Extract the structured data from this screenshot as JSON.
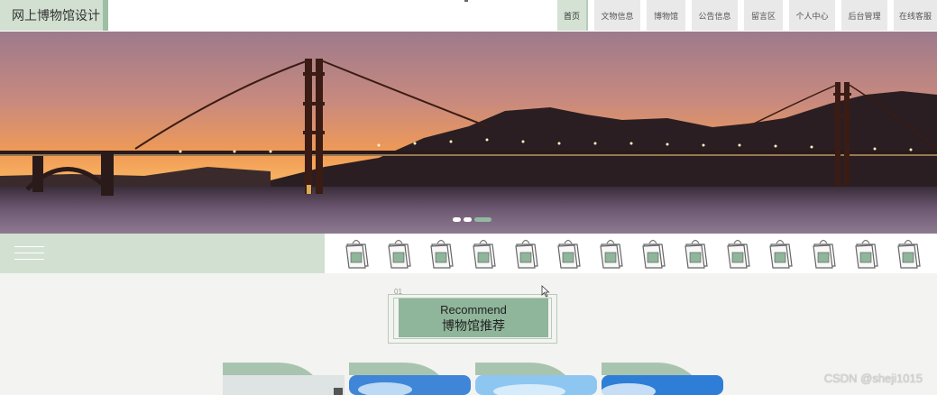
{
  "header": {
    "logo_text": "网上博物馆设计",
    "nav": [
      {
        "label": "首页",
        "active": true
      },
      {
        "label": "文物信息"
      },
      {
        "label": "博物馆"
      },
      {
        "label": "公告信息"
      },
      {
        "label": "留言区"
      },
      {
        "label": "个人中心"
      },
      {
        "label": "后台管理"
      },
      {
        "label": "在线客服"
      }
    ]
  },
  "carousel": {
    "slide_count": 3,
    "active_index": 2
  },
  "icon_strip": {
    "icon": "bag-icon",
    "count": 14
  },
  "recommend": {
    "number": "01",
    "title_en": "Recommend",
    "title_cn": "博物馆推荐"
  },
  "watermark": "CSDN @sheji1015",
  "colors": {
    "accent": "#8fb59a",
    "accent_light": "#d2e0d1",
    "page_bg": "#f3f3f1"
  }
}
